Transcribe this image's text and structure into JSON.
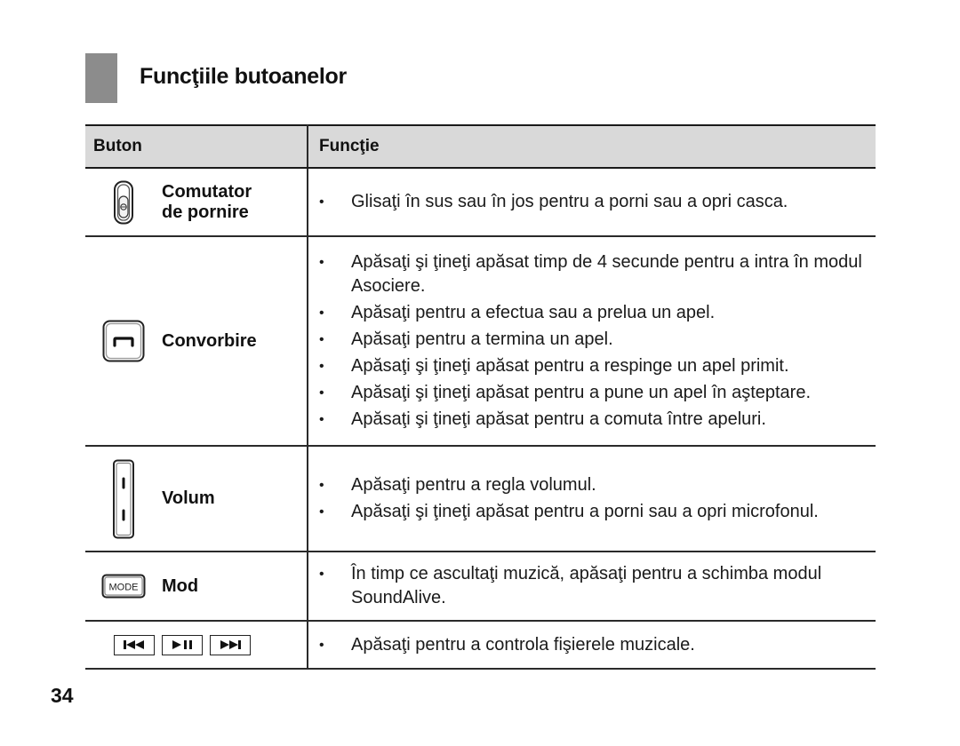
{
  "document": {
    "section_title": "Funcţiile butoanelor",
    "page_number": "34"
  },
  "table": {
    "headers": {
      "button": "Buton",
      "function": "Funcţie"
    },
    "rows": [
      {
        "button_label": "Comutator de pornire",
        "icon": "power-switch-icon",
        "functions": [
          "Glisaţi în sus sau în jos pentru a porni sau a opri casca."
        ]
      },
      {
        "button_label": "Convorbire",
        "icon": "call-button-icon",
        "functions": [
          "Apăsaţi şi ţineţi apăsat timp de 4 secunde pentru a intra în modul Asociere.",
          "Apăsaţi pentru a efectua sau a prelua un apel.",
          "Apăsaţi pentru a termina un apel.",
          "Apăsaţi şi ţineţi apăsat pentru a respinge un apel primit.",
          "Apăsaţi şi ţineţi apăsat pentru a pune un apel în aşteptare.",
          "Apăsaţi şi ţineţi apăsat pentru a comuta între apeluri."
        ]
      },
      {
        "button_label": "Volum",
        "icon": "volume-rocker-icon",
        "functions": [
          "Apăsaţi pentru a regla volumul.",
          "Apăsaţi şi ţineţi apăsat pentru a porni sau a opri microfonul."
        ]
      },
      {
        "button_label": "Mod",
        "icon": "mode-button-icon",
        "icon_text": "MODE",
        "functions": [
          "În timp ce ascultaţi muzică, apăsaţi pentru a schimba modul SoundAlive."
        ]
      },
      {
        "button_label": "",
        "icons": [
          "previous-track-icon",
          "play-pause-icon",
          "next-track-icon"
        ],
        "functions": [
          "Apăsaţi pentru a controla fişierele muzicale."
        ]
      }
    ]
  },
  "colors": {
    "title_block": "#8c8c8c",
    "header_background": "#d9d9d9",
    "rule": "#1a1a1a"
  }
}
